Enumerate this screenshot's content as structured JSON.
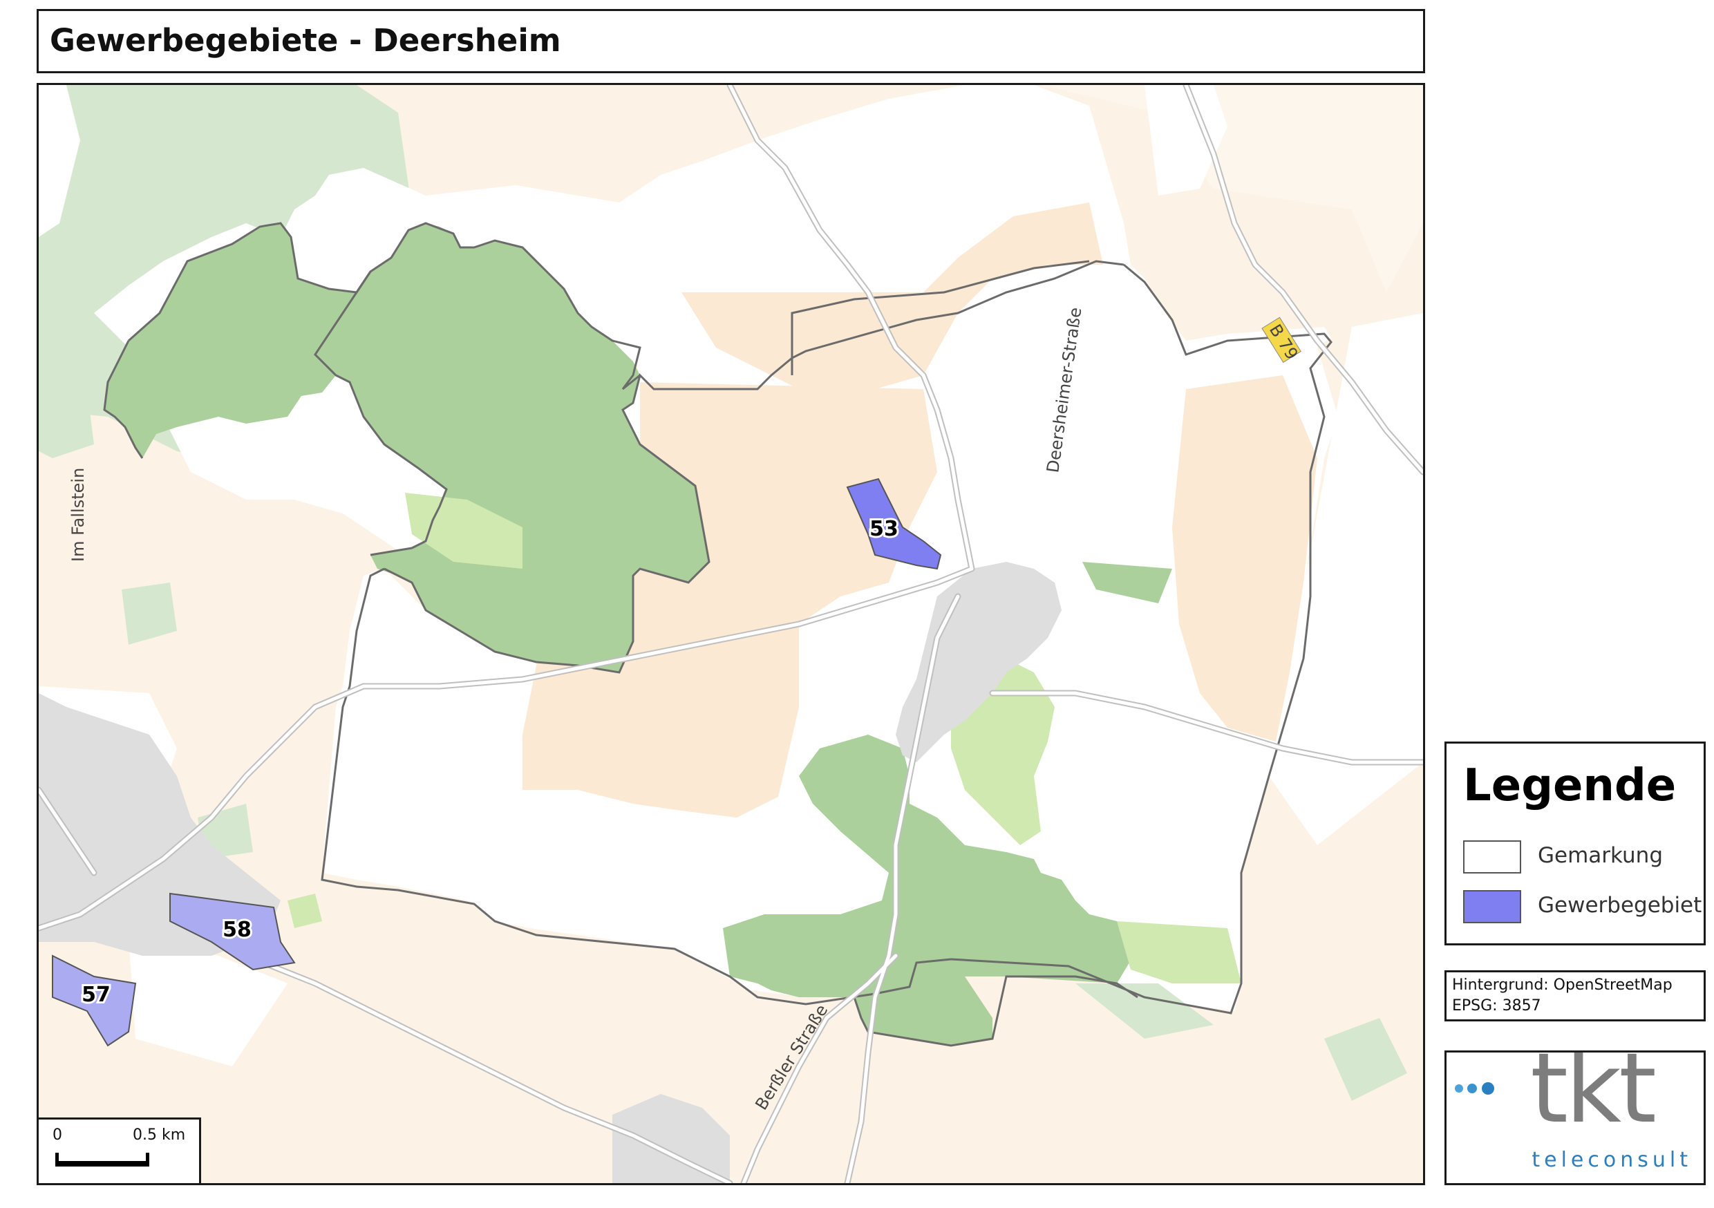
{
  "title": "Gewerbegebiete - Deersheim",
  "map": {
    "road_labels": {
      "falstein": "Im Fallstein",
      "deersheimer": "Deersheimer-Straße",
      "b79": "B 79",
      "berssler": "Berßler Straße"
    },
    "areas": [
      {
        "id": "53",
        "label": "53"
      },
      {
        "id": "58",
        "label": "58"
      },
      {
        "id": "57",
        "label": "57"
      }
    ],
    "scale_bar": {
      "left": "0",
      "right": "0.5 km"
    },
    "colors": {
      "gewerbegebiet": "#7f7ff2",
      "gewerbegebiet_light": "#ababf2",
      "forest_dark": "#abd09b",
      "forest_light": "#d5e8cf",
      "meadow": "#cfe9b0",
      "farmland": "#fbeedb",
      "farmland_dark": "#f9e5cf",
      "urban": "#dedede",
      "boundary": "#6b6b6b"
    }
  },
  "legend": {
    "title": "Legende",
    "items": [
      {
        "label": "Gemarkung",
        "swatch": "#ffffff"
      },
      {
        "label": "Gewerbegebiet",
        "swatch": "#7f7ff2"
      }
    ]
  },
  "source": {
    "line1": "Hintergrund: OpenStreetMap",
    "line2": "EPSG: 3857"
  },
  "logo": {
    "brand": "tkt",
    "tagline": "teleconsult"
  }
}
